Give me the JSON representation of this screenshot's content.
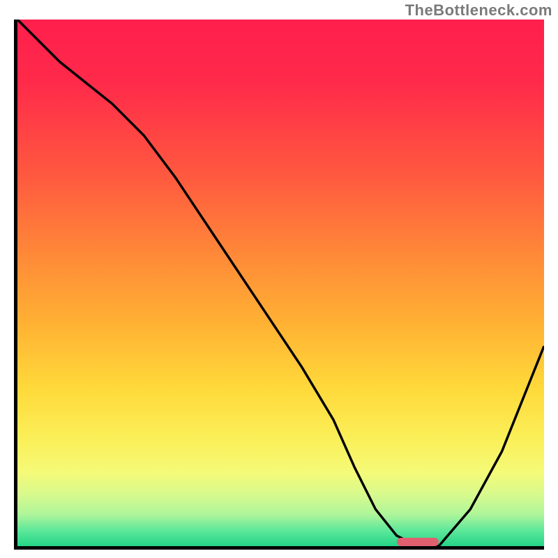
{
  "watermark": "TheBottleneck.com",
  "colors": {
    "axis": "#000000",
    "curve": "#000000",
    "marker": "#e06070",
    "gradient_top": "#ff1f4d",
    "gradient_bottom": "#24d487"
  },
  "chart_data": {
    "type": "line",
    "title": "",
    "xlabel": "",
    "ylabel": "",
    "xlim": [
      0,
      100
    ],
    "ylim": [
      0,
      100
    ],
    "grid": false,
    "series": [
      {
        "name": "bottleneck-curve",
        "x": [
          0,
          8,
          18,
          24,
          30,
          38,
          46,
          54,
          60,
          64,
          68,
          72,
          76,
          80,
          86,
          92,
          100
        ],
        "values": [
          100,
          92,
          84,
          78,
          70,
          58,
          46,
          34,
          24,
          15,
          7,
          2,
          0,
          0,
          7,
          18,
          38
        ]
      }
    ],
    "marker": {
      "x_start": 72,
      "x_end": 80,
      "y": 0
    }
  }
}
